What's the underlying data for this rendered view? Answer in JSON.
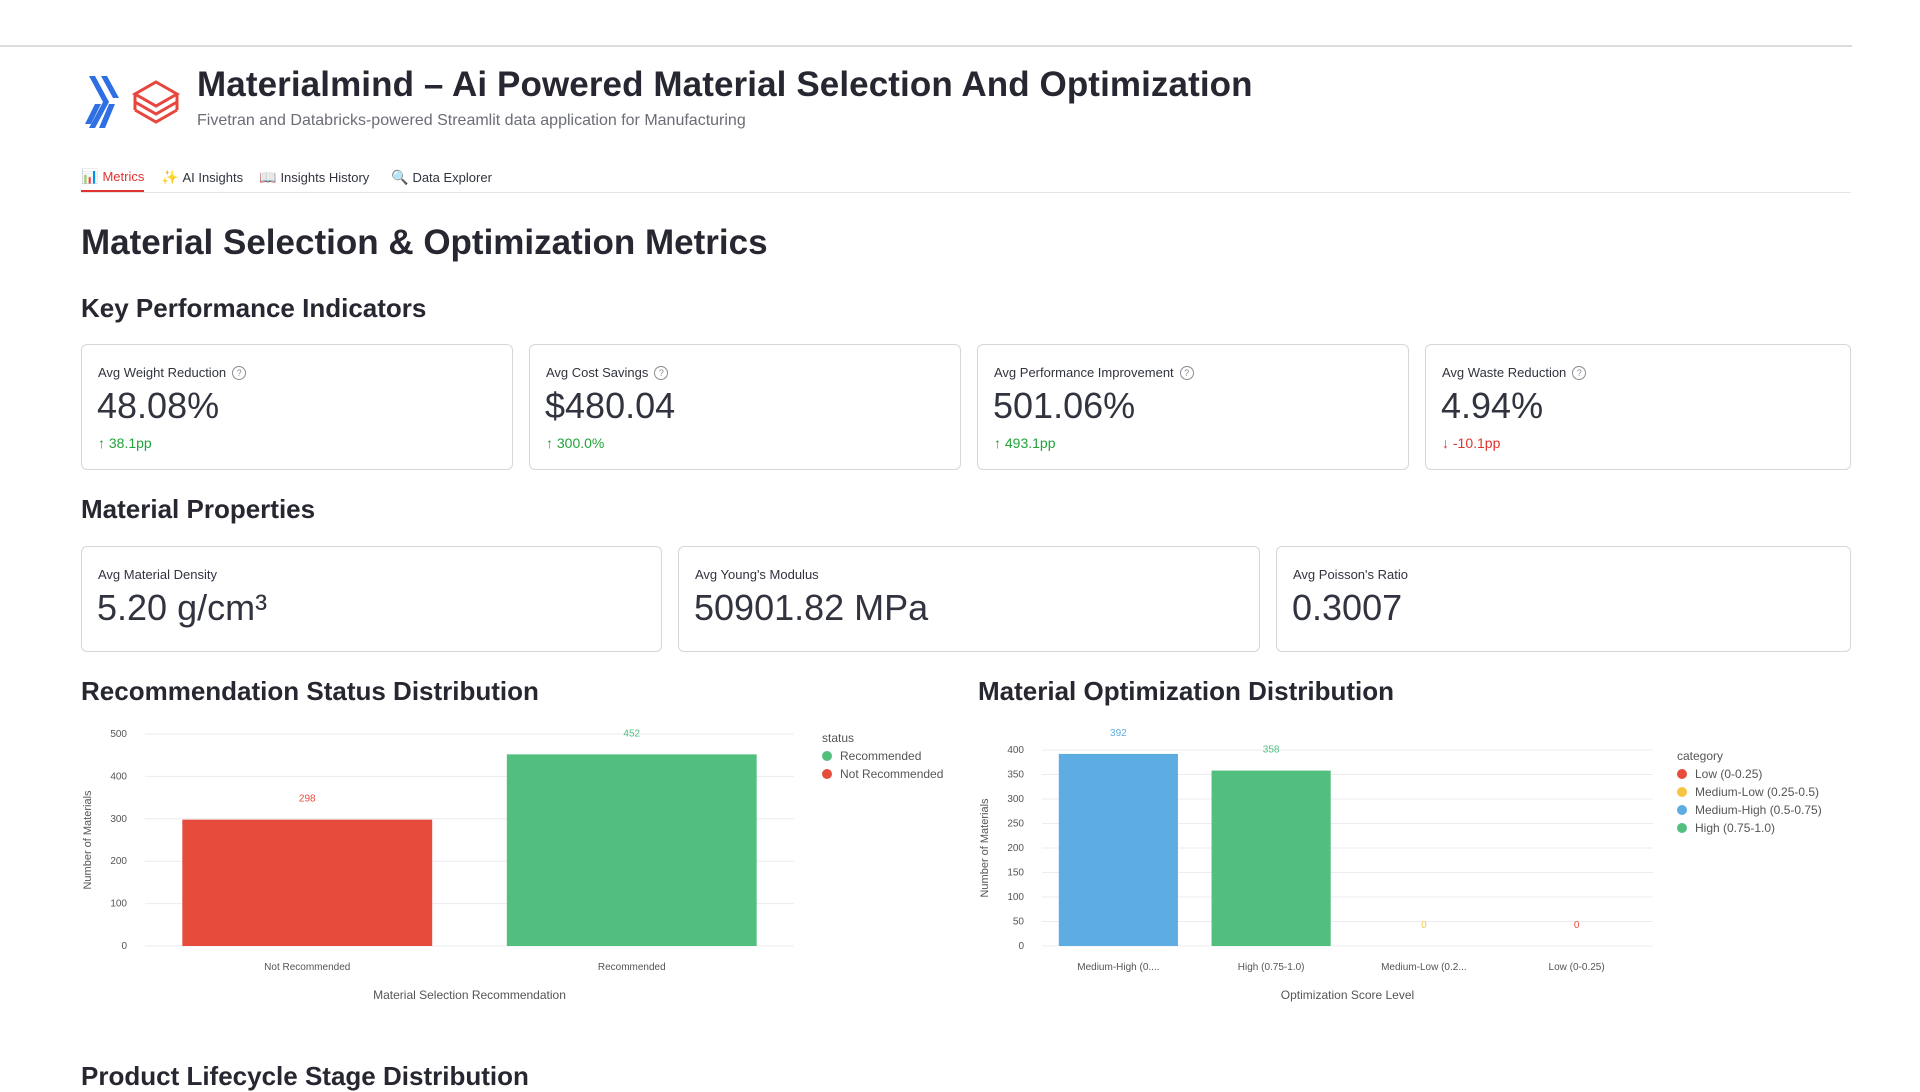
{
  "app": {
    "title": "Materialmind – Ai Powered Material Selection And Optimization",
    "subtitle": "Fivetran and Databricks-powered Streamlit data application for Manufacturing"
  },
  "tabs": [
    {
      "label": "Metrics",
      "icon": "bar-chart-icon",
      "active": true
    },
    {
      "label": "AI Insights",
      "icon": "sparkles-icon",
      "active": false
    },
    {
      "label": "Insights History",
      "icon": "book-icon",
      "active": false
    },
    {
      "label": "Data Explorer",
      "icon": "magnifier-icon",
      "active": false
    }
  ],
  "page_title": "Material Selection & Optimization Metrics",
  "kpi_section": {
    "title": "Key Performance Indicators",
    "cards": [
      {
        "label": "Avg Weight Reduction",
        "value": "48.08%",
        "delta": "38.1pp",
        "direction": "up"
      },
      {
        "label": "Avg Cost Savings",
        "value": "$480.04",
        "delta": "300.0%",
        "direction": "up"
      },
      {
        "label": "Avg Performance Improvement",
        "value": "501.06%",
        "delta": "493.1pp",
        "direction": "up"
      },
      {
        "label": "Avg Waste Reduction",
        "value": "4.94%",
        "delta": "-10.1pp",
        "direction": "down"
      }
    ]
  },
  "properties_section": {
    "title": "Material Properties",
    "cards": [
      {
        "label": "Avg Material Density",
        "value": "5.20 g/cm³"
      },
      {
        "label": "Avg Young's Modulus",
        "value": "50901.82 MPa"
      },
      {
        "label": "Avg Poisson's Ratio",
        "value": "0.3007"
      }
    ]
  },
  "colors": {
    "accent": "#e0332f",
    "up": "#21a33a",
    "down": "#e0332f",
    "red": "#e64b3b",
    "green": "#52bf7f",
    "blue": "#5dade2",
    "yellow": "#f5c542"
  },
  "charts_titles": {
    "left": "Recommendation Status Distribution",
    "right": "Material Optimization Distribution",
    "bottom": "Product Lifecycle Stage Distribution"
  },
  "chart_data": [
    {
      "type": "bar",
      "title": "Recommendation Status Distribution",
      "xlabel": "Material Selection Recommendation",
      "ylabel": "Number of Materials",
      "categories": [
        "Not Recommended",
        "Recommended"
      ],
      "values": [
        298,
        452
      ],
      "bar_colors": [
        "#e64b3b",
        "#52bf7f"
      ],
      "ylim": [
        0,
        500
      ],
      "yticks": [
        0,
        100,
        200,
        300,
        400,
        500
      ],
      "legend": {
        "title": "status",
        "position": "right",
        "items": [
          {
            "name": "Recommended",
            "color": "#52bf7f"
          },
          {
            "name": "Not Recommended",
            "color": "#e64b3b"
          }
        ]
      },
      "grid": true
    },
    {
      "type": "bar",
      "title": "Material Optimization Distribution",
      "xlabel": "Optimization Score Level",
      "ylabel": "Number of Materials",
      "categories": [
        "Medium-High (0....",
        "High (0.75-1.0)",
        "Medium-Low (0.2...",
        "Low (0-0.25)"
      ],
      "values": [
        392,
        358,
        0,
        0
      ],
      "bar_colors": [
        "#5dade2",
        "#52bf7f",
        "#f5c542",
        "#e64b3b"
      ],
      "ylim": [
        0,
        400
      ],
      "yticks": [
        0,
        50,
        100,
        150,
        200,
        250,
        300,
        350,
        400
      ],
      "legend": {
        "title": "category",
        "position": "right",
        "items": [
          {
            "name": "Low (0-0.25)",
            "color": "#e64b3b"
          },
          {
            "name": "Medium-Low (0.25-0.5)",
            "color": "#f5c542"
          },
          {
            "name": "Medium-High (0.5-0.75)",
            "color": "#5dade2"
          },
          {
            "name": "High (0.75-1.0)",
            "color": "#52bf7f"
          }
        ]
      },
      "grid": true
    }
  ]
}
